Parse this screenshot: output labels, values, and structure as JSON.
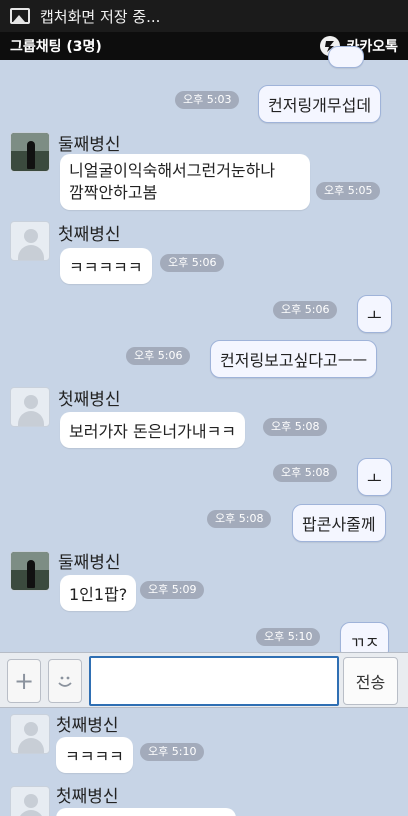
{
  "status_bar": {
    "text": "캡처화면 저장 중..."
  },
  "header": {
    "title": "그룹채팅 (3명)",
    "brand": "카카오톡"
  },
  "messages": [
    {
      "type": "sent",
      "text": "컨저링개무섭데",
      "time": "오후 5:03"
    },
    {
      "type": "received",
      "sender": "둘째병신",
      "avatar": "photo",
      "lines": [
        "니얼굴이익숙해서그런거눈하나",
        "깜짝안하고봄"
      ],
      "time": "오후 5:05"
    },
    {
      "type": "received",
      "sender": "첫째병신",
      "avatar": "default",
      "text": "ㅋㅋㅋㅋㅋ",
      "time": "오후 5:06"
    },
    {
      "type": "sent",
      "text": "ㅗ",
      "time": "오후 5:06"
    },
    {
      "type": "sent",
      "text": "컨저링보고싶다고ㅡㅡ",
      "time": "오후 5:06"
    },
    {
      "type": "received",
      "sender": "첫째병신",
      "avatar": "default",
      "text": "보러가자 돈은너가내ㅋㅋ",
      "time": "오후 5:08"
    },
    {
      "type": "sent",
      "text": "ㅗ",
      "time": "오후 5:08"
    },
    {
      "type": "sent",
      "text": "팝콘사줄께",
      "time": "오후 5:08"
    },
    {
      "type": "received",
      "sender": "둘째병신",
      "avatar": "photo",
      "text": "1인1팝?",
      "time": "오후 5:09"
    },
    {
      "type": "sent",
      "text": "ㄲㅈ",
      "time": "오후 5:10"
    },
    {
      "type": "received",
      "sender": "첫째병신",
      "avatar": "default",
      "text": "ㅋㅋㅋㅋ",
      "time": "오후 5:10"
    },
    {
      "type": "received",
      "sender": "첫째병신",
      "avatar": "default",
      "text": "",
      "time": ""
    }
  ],
  "input_bar": {
    "add_icon": "plus-icon",
    "emoticon_icon": "smiley-icon",
    "input_value": "",
    "send_label": "전송"
  }
}
